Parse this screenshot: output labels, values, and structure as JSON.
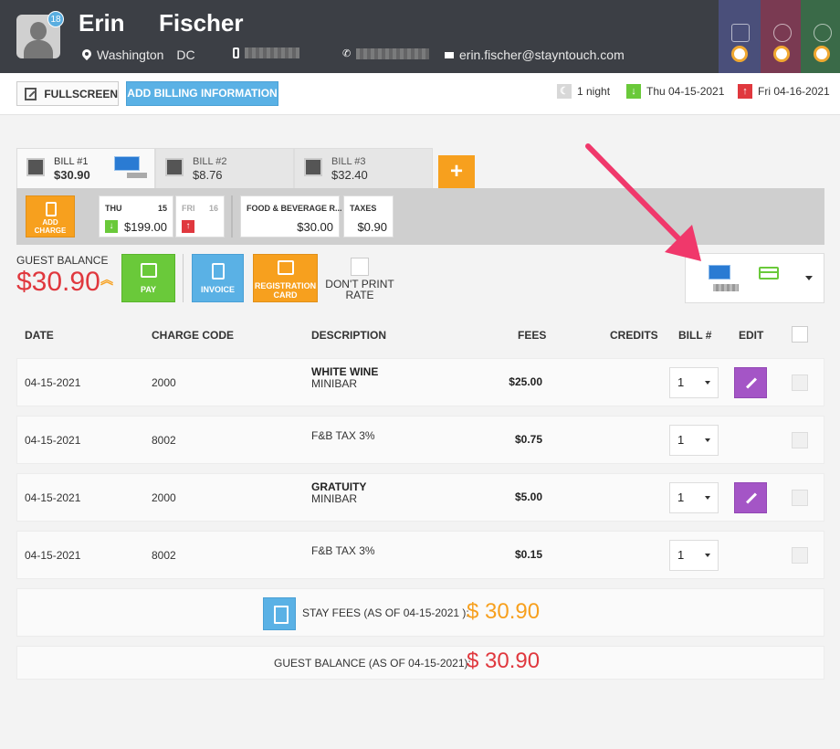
{
  "guest": {
    "first_name": "Erin",
    "last_name": "Fischer",
    "notification_count": "18",
    "city": "Washington",
    "state": "DC",
    "email": "erin.fischer@stayntouch.com"
  },
  "toolbar": {
    "fullscreen_label": "FULLSCREEN",
    "add_billing_label": "ADD BILLING INFORMATION",
    "nights": "1 night",
    "arrival": "Thu 04-15-2021",
    "departure": "Fri 04-16-2021"
  },
  "bills": [
    {
      "label": "BILL #1",
      "amount": "$30.90",
      "active": true
    },
    {
      "label": "BILL #2",
      "amount": "$8.76",
      "active": false
    },
    {
      "label": "BILL #3",
      "amount": "$32.40",
      "active": false
    }
  ],
  "add_bill_label": "+",
  "add_charge_label": "ADD CHARGE",
  "days": [
    {
      "name": "THU",
      "num": "15",
      "value": "$199.00",
      "arrow": "↓",
      "arrow_color": "#6ac93a"
    },
    {
      "name": "FRI",
      "num": "16",
      "value": "",
      "arrow": "↑",
      "arrow_color": "#e0383e"
    }
  ],
  "categories": [
    {
      "name": "FOOD & BEVERAGE R...",
      "value": "$30.00"
    },
    {
      "name": "TAXES",
      "value": "$0.90"
    }
  ],
  "balance": {
    "label": "GUEST BALANCE",
    "amount": "$30.90",
    "chevron": "︽"
  },
  "actions": {
    "pay": "PAY",
    "invoice": "INVOICE",
    "registration": "REGISTRATION CARD",
    "dont_print": "DON'T PRINT RATE"
  },
  "table": {
    "headers": {
      "date": "DATE",
      "charge_code": "CHARGE CODE",
      "description": "DESCRIPTION",
      "fees": "FEES",
      "credits": "CREDITS",
      "bill": "BILL #",
      "edit": "EDIT"
    },
    "rows": [
      {
        "date": "04-15-2021",
        "code": "2000",
        "desc1": "WHITE WINE",
        "desc2": "MINIBAR",
        "fee": "$25.00",
        "bill": "1",
        "editable": true
      },
      {
        "date": "04-15-2021",
        "code": "8002",
        "desc1": "",
        "desc2": "F&B TAX 3%",
        "fee": "$0.75",
        "bill": "1",
        "editable": false
      },
      {
        "date": "04-15-2021",
        "code": "2000",
        "desc1": "GRATUITY",
        "desc2": "MINIBAR",
        "fee": "$5.00",
        "bill": "1",
        "editable": true
      },
      {
        "date": "04-15-2021",
        "code": "8002",
        "desc1": "",
        "desc2": "F&B TAX 3%",
        "fee": "$0.15",
        "bill": "1",
        "editable": false
      }
    ]
  },
  "summary": {
    "stay_fees_label": "STAY FEES (AS OF 04-15-2021 ):",
    "stay_fees_value": "$ 30.90",
    "guest_balance_label": "GUEST BALANCE (AS OF 04-15-2021):",
    "guest_balance_value": "$ 30.90"
  },
  "colors": {
    "header_bg": "#3c3f45",
    "accent_orange": "#f7a01e",
    "accent_blue": "#5ab1e5",
    "accent_green": "#6ac93a",
    "accent_purple": "#a455c6",
    "balance_red": "#e0383e",
    "annotation_pink": "#f0386b"
  },
  "header_tiles": [
    {
      "color": "#4a4f7a",
      "icon": "building-icon"
    },
    {
      "color": "#7a3a52",
      "icon": "globe-icon"
    },
    {
      "color": "#3a6a48",
      "icon": "circles-icon"
    }
  ]
}
